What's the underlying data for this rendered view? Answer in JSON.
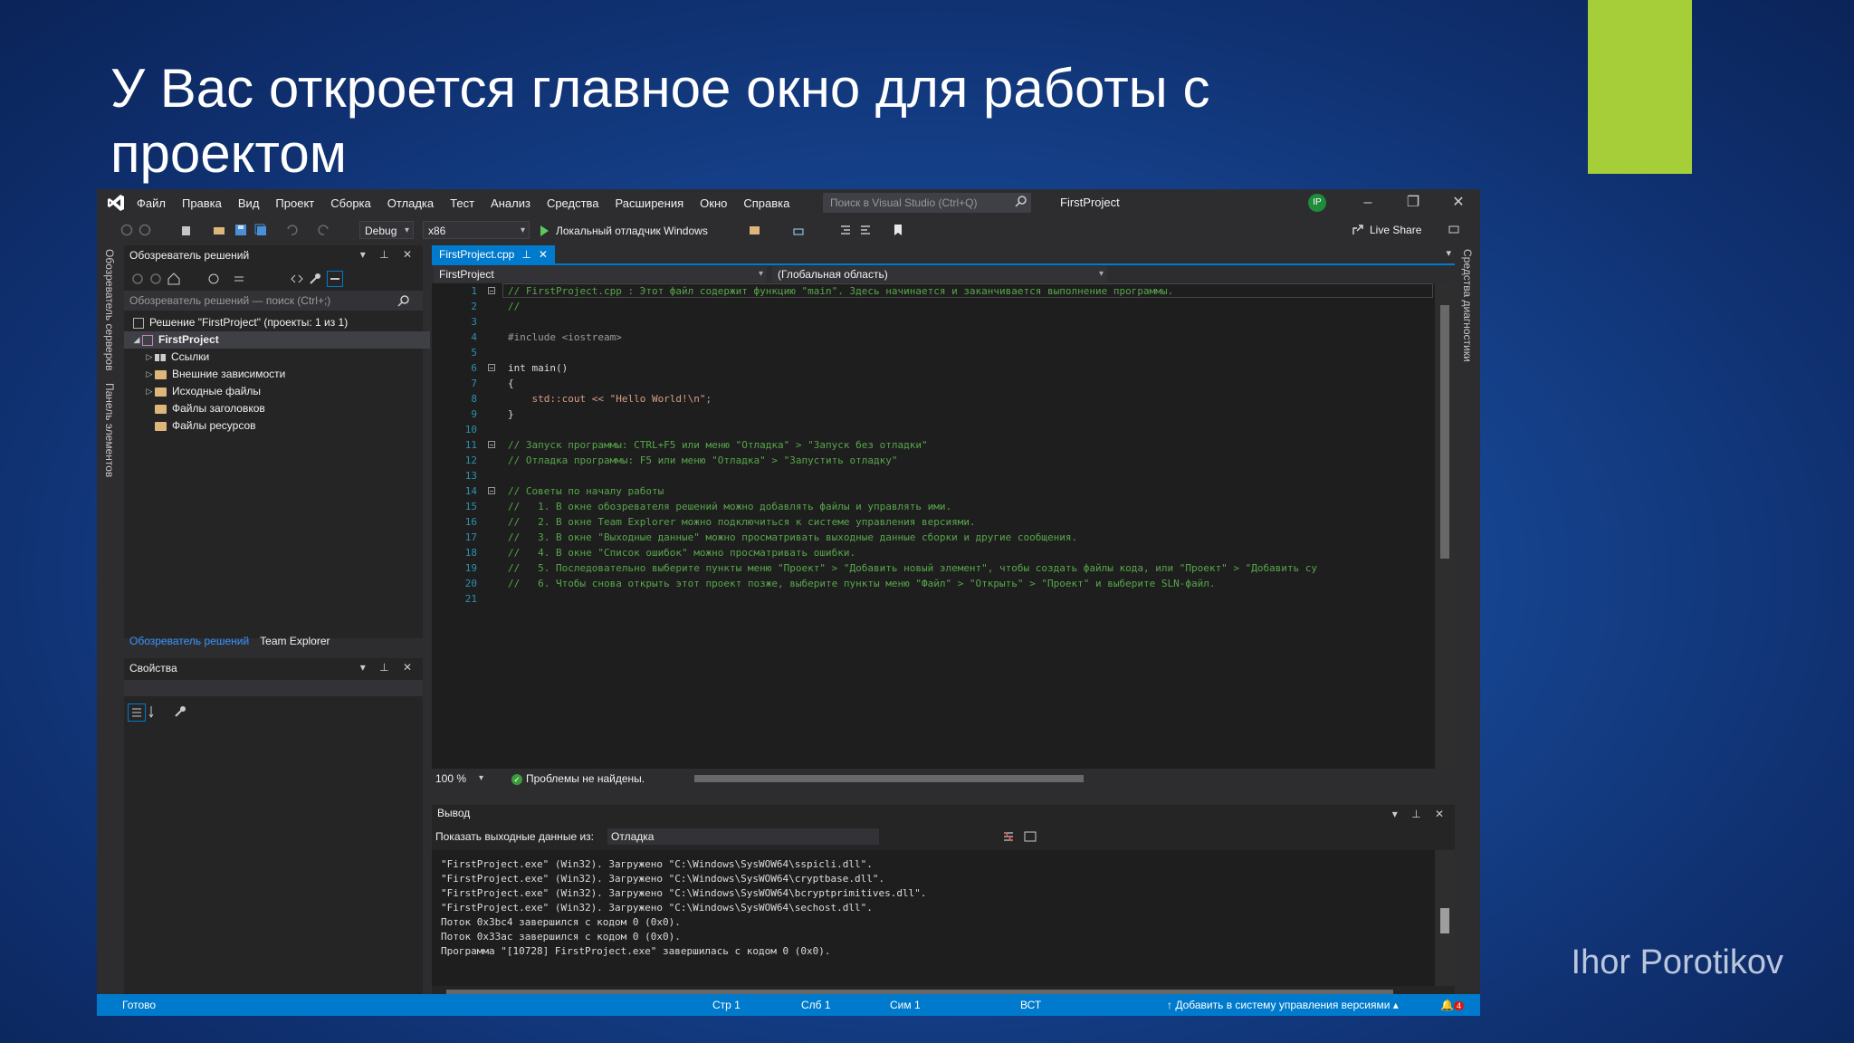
{
  "slide": {
    "title": "У Вас откроется главное окно для работы с проектом",
    "author": "Ihor Porotikov",
    "accent_color": "#a6ce39"
  },
  "vs": {
    "menu": [
      "Файл",
      "Правка",
      "Вид",
      "Проект",
      "Сборка",
      "Отладка",
      "Тест",
      "Анализ",
      "Средства",
      "Расширения",
      "Окно",
      "Справка"
    ],
    "search_placeholder": "Поиск в Visual Studio (Ctrl+Q)",
    "project_name": "FirstProject",
    "user_initials": "IP",
    "toolbar": {
      "config": "Debug",
      "platform": "x86",
      "run_label": "Локальный отладчик Windows",
      "live_share": "Live Share"
    },
    "left_rail": [
      "Обозреватель серверов",
      "Панель элементов"
    ],
    "right_rail": "Средства диагностики",
    "solution_explorer": {
      "title": "Обозреватель решений",
      "search_placeholder": "Обозреватель решений — поиск (Ctrl+;)",
      "tree": [
        {
          "label": "Решение \"FirstProject\" (проекты: 1 из 1)",
          "icon": "solution-icon"
        },
        {
          "label": "FirstProject",
          "icon": "project-icon"
        },
        {
          "label": "Ссылки",
          "icon": "references-icon"
        },
        {
          "label": "Внешние зависимости",
          "icon": "folder-icon"
        },
        {
          "label": "Исходные файлы",
          "icon": "folder-icon"
        },
        {
          "label": "Файлы заголовков",
          "icon": "folder-icon"
        },
        {
          "label": "Файлы ресурсов",
          "icon": "folder-icon"
        }
      ],
      "tabs": [
        "Обозреватель решений",
        "Team Explorer"
      ]
    },
    "properties": {
      "title": "Свойства"
    },
    "editor": {
      "tab": "FirstProject.cpp",
      "nav_project": "FirstProject",
      "nav_scope": "(Глобальная область)",
      "lines": [
        "// FirstProject.cpp : Этот файл содержит функцию \"main\". Здесь начинается и заканчивается выполнение программы.",
        "//",
        "",
        "#include <iostream>",
        "",
        "int main()",
        "{",
        "    std::cout << \"Hello World!\\n\";",
        "}",
        "",
        "// Запуск программы: CTRL+F5 или меню \"Отладка\" > \"Запуск без отладки\"",
        "// Отладка программы: F5 или меню \"Отладка\" > \"Запустить отладку\"",
        "",
        "// Советы по началу работы",
        "//   1. В окне обозревателя решений можно добавлять файлы и управлять ими.",
        "//   2. В окне Team Explorer можно подключиться к системе управления версиями.",
        "//   3. В окне \"Выходные данные\" можно просматривать выходные данные сборки и другие сообщения.",
        "//   4. В окне \"Список ошибок\" можно просматривать ошибки.",
        "//   5. Последовательно выберите пункты меню \"Проект\" > \"Добавить новый элемент\", чтобы создать файлы кода, или \"Проект\" > \"Добавить су",
        "//   6. Чтобы снова открыть этот проект позже, выберите пункты меню \"Файл\" > \"Открыть\" > \"Проект\" и выберите SLN-файл.",
        ""
      ],
      "zoom": "100 %",
      "issues": "Проблемы не найдены."
    },
    "output": {
      "title": "Вывод",
      "source_label": "Показать выходные данные из:",
      "source_value": "Отладка",
      "lines": [
        "\"FirstProject.exe\" (Win32). Загружено \"C:\\Windows\\SysWOW64\\sspicli.dll\".",
        "\"FirstProject.exe\" (Win32). Загружено \"C:\\Windows\\SysWOW64\\cryptbase.dll\".",
        "\"FirstProject.exe\" (Win32). Загружено \"C:\\Windows\\SysWOW64\\bcryptprimitives.dll\".",
        "\"FirstProject.exe\" (Win32). Загружено \"C:\\Windows\\SysWOW64\\sechost.dll\".",
        "Поток 0x3bc4 завершился с кодом 0 (0x0).",
        "Поток 0x33ac завершился с кодом 0 (0x0).",
        "Программа \"[10728] FirstProject.exe\" завершилась с кодом 0 (0x0)."
      ]
    },
    "status": {
      "ready": "Готово",
      "line": "Стр 1",
      "col": "Слб 1",
      "char": "Сим 1",
      "mode": "ВСТ",
      "source_control": "Добавить в систему управления версиями",
      "notifications": "4"
    }
  }
}
